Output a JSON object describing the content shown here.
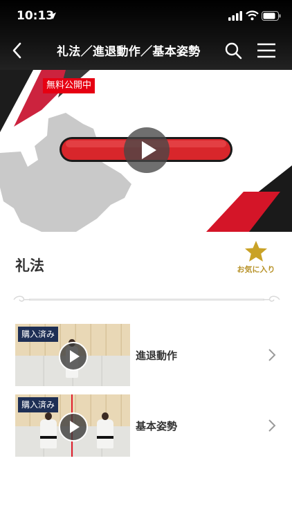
{
  "status_bar": {
    "time": "10:13"
  },
  "header": {
    "title": "礼法／進退動作／基本姿勢"
  },
  "hero": {
    "badge": "無料公開中"
  },
  "section": {
    "title": "礼法",
    "favorite_label": "お気に入り"
  },
  "lessons": [
    {
      "badge": "購入済み",
      "label": "進退動作"
    },
    {
      "badge": "購入済み",
      "label": "基本姿勢"
    }
  ],
  "colors": {
    "accent_red": "#e60012",
    "favorite_gold": "#c9a227",
    "badge_navy": "#1e2f55"
  }
}
